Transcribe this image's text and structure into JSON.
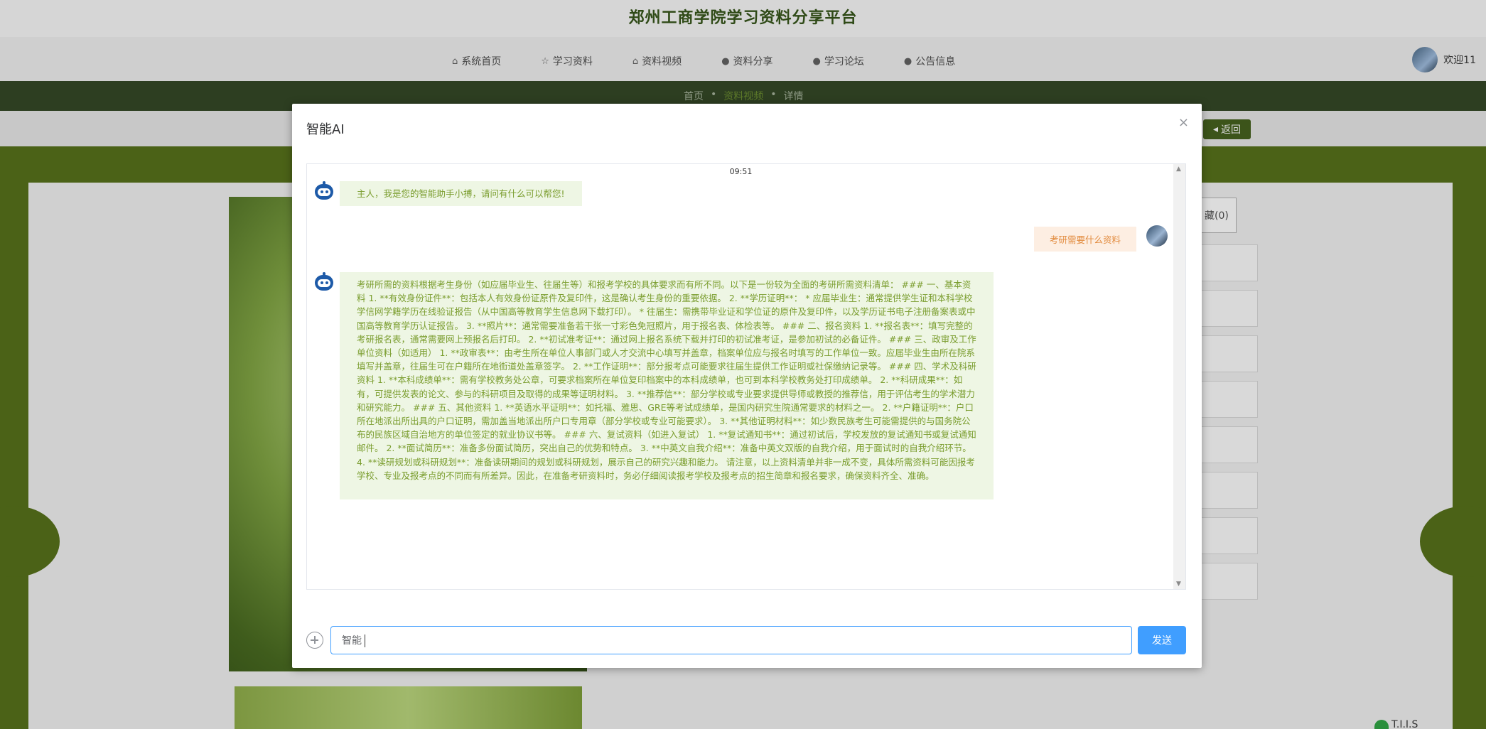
{
  "site": {
    "title": "郑州工商学院学习资料分享平台"
  },
  "nav": {
    "items": [
      {
        "icon": "home-icon",
        "glyph": "⌂",
        "label": "系统首页"
      },
      {
        "icon": "star-icon",
        "glyph": "☆",
        "label": "学习资料"
      },
      {
        "icon": "video-icon",
        "glyph": "⌂",
        "label": "资料视频"
      },
      {
        "icon": "info-icon",
        "glyph": "●",
        "label": "资料分享"
      },
      {
        "icon": "question-icon",
        "glyph": "●",
        "label": "学习论坛"
      },
      {
        "icon": "info-icon",
        "glyph": "●",
        "label": "公告信息"
      }
    ],
    "user_greeting": "欢迎11"
  },
  "breadcrumb": {
    "home": "首页",
    "section": "资料视频",
    "current": "详情",
    "separator": "•"
  },
  "page": {
    "back_label": "返回",
    "favorites_label": "藏(0)",
    "corner_brand": "T.I.I.S"
  },
  "modal": {
    "title": "智能AI",
    "close_glyph": "×",
    "chat": {
      "timestamp": "09:51",
      "messages": [
        {
          "role": "bot",
          "text": "主人，我是您的智能助手小搏，请问有什么可以帮您!"
        },
        {
          "role": "user",
          "text": "考研需要什么资料"
        },
        {
          "role": "bot",
          "text": "考研所需的资料根据考生身份（如应届毕业生、往届生等）和报考学校的具体要求而有所不同。以下是一份较为全面的考研所需资料清单： ### 一、基本资料 1. **有效身份证件**：包括本人有效身份证原件及复印件，这是确认考生身份的重要依据。 2. **学历证明**： * 应届毕业生：通常提供学生证和本科学校学信网学籍学历在线验证报告（从中国高等教育学生信息网下载打印）。 * 往届生：需携带毕业证和学位证的原件及复印件，以及学历证书电子注册备案表或中国高等教育学历认证报告。 3. **照片**：通常需要准备若干张一寸彩色免冠照片，用于报名表、体检表等。 ### 二、报名资料 1. **报名表**：填写完整的考研报名表，通常需要网上预报名后打印。 2. **初试准考证**：通过网上报名系统下载并打印的初试准考证，是参加初试的必备证件。 ### 三、政审及工作单位资料（如适用） 1. **政审表**：由考生所在单位人事部门或人才交流中心填写并盖章，档案单位应与报名时填写的工作单位一致。应届毕业生由所在院系填写并盖章，往届生可在户籍所在地街道处盖章签字。 2. **工作证明**：部分报考点可能要求往届生提供工作证明或社保缴纳记录等。 ### 四、学术及科研资料 1. **本科成绩单**：需有学校教务处公章，可要求档案所在单位复印档案中的本科成绩单，也可到本科学校教务处打印成绩单。 2. **科研成果**：如有，可提供发表的论文、参与的科研项目及取得的成果等证明材料。 3. **推荐信**：部分学校或专业要求提供导师或教授的推荐信，用于评估考生的学术潜力和研究能力。 ### 五、其他资料 1. **英语水平证明**：如托福、雅思、GRE等考试成绩单，是国内研究生院通常要求的材料之一。 2. **户籍证明**：户口所在地派出所出具的户口证明，需加盖当地派出所户口专用章（部分学校或专业可能要求）。 3. **其他证明材料**：如少数民族考生可能需提供的与国务院公布的民族区域自治地方的单位签定的就业协议书等。 ### 六、复试资料（如进入复试） 1. **复试通知书**：通过初试后，学校发放的复试通知书或复试通知邮件。 2. **面试简历**：准备多份面试简历，突出自己的优势和特点。 3. **中英文自我介绍**：准备中英文双版的自我介绍，用于面试时的自我介绍环节。 4. **读研规划或科研规划**：准备读研期间的规划或科研规划，展示自己的研究兴趣和能力。 请注意，以上资料清单并非一成不变，具体所需资料可能因报考学校、专业及报考点的不同而有所差异。因此，在准备考研资料时，务必仔细阅读报考学校及报考点的招生简章和报名要求，确保资料齐全、准确。"
        }
      ]
    },
    "input": {
      "value": "智能",
      "placeholder": ""
    },
    "send_label": "发送"
  },
  "colors": {
    "accent": "#409eff",
    "bot_text": "#7a9d2e",
    "bot_bubble": "#eef6e4",
    "user_text": "#e28b3e",
    "user_bubble": "#fdeee2"
  }
}
